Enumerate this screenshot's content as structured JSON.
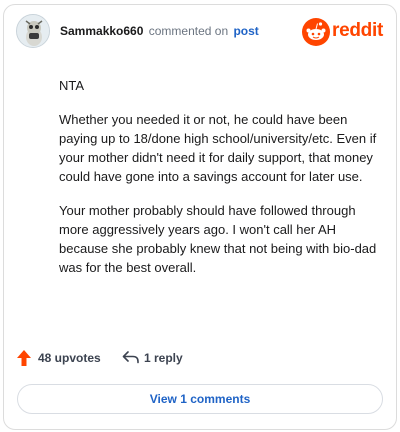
{
  "comment": {
    "username": "Sammakko660",
    "action_text": "commented on",
    "post_link": "post",
    "paragraphs": [
      "NTA",
      "Whether you needed it or not, he could have been paying up to 18/done high school/university/etc. Even if your mother didn't need it for daily support, that money could have gone into a savings account for later use.",
      "Your mother probably should have followed through more aggressively years ago. I won't call her AH because she probably knew that not being with bio-dad was for the best overall."
    ]
  },
  "brand": {
    "wordmark": "reddit",
    "color": "#ff4500",
    "icon": "reddit-logo-icon"
  },
  "actions": {
    "upvotes_label": "48 upvotes",
    "reply_label": "1 reply",
    "upvote_icon": "upvote-arrow-icon",
    "reply_icon": "reply-arrow-icon"
  },
  "footer": {
    "view_comments_label": "View 1 comments"
  },
  "colors": {
    "accent": "#ff4500",
    "link": "#1f63c6",
    "muted": "#6b7480"
  }
}
